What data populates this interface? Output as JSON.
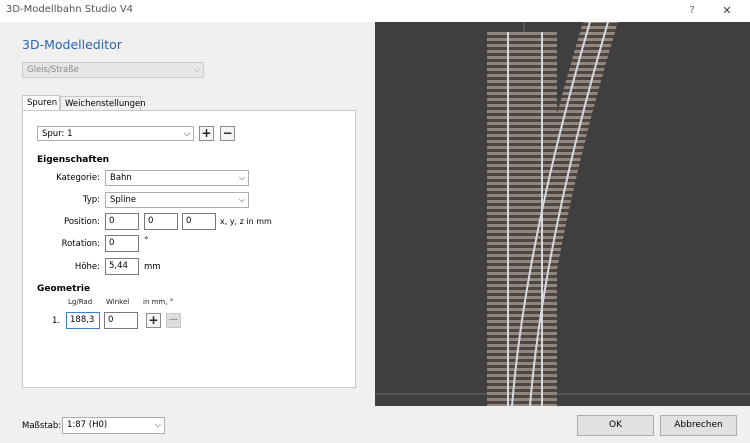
{
  "window": {
    "title": "3D-Modellbahn Studio V4",
    "help": "?",
    "close": "✕"
  },
  "editor": {
    "title": "3D-Modelleditor",
    "type_select": {
      "value": "Gleis/Straße"
    },
    "tabs": [
      {
        "label": "Spuren"
      },
      {
        "label": "Weichenstellungen"
      }
    ],
    "track_select": {
      "value": "Spur: 1"
    },
    "add": "+",
    "remove": "−",
    "properties": {
      "heading": "Eigenschaften",
      "category_label": "Kategorie:",
      "category_value": "Bahn",
      "type_label": "Typ:",
      "type_value": "Spline",
      "position_label": "Position:",
      "position_x": "0",
      "position_y": "0",
      "position_z": "0",
      "position_unit": "x, y, z in mm",
      "rotation_label": "Rotation:",
      "rotation_value": "0",
      "rotation_unit": "°",
      "height_label": "Höhe:",
      "height_value": "5,44",
      "height_unit": "mm"
    },
    "geometry": {
      "heading": "Geometrie",
      "col_length": "Lg/Rad",
      "col_angle": "Winkel",
      "col_unit": "in mm, °",
      "rows": [
        {
          "index": "1.",
          "length": "188,3",
          "angle": "0"
        }
      ],
      "add": "+",
      "remove": "—"
    }
  },
  "footer": {
    "scale_label": "Maßstab:",
    "scale_value": "1:87 (H0)",
    "ok": "OK",
    "cancel": "Abbrechen"
  },
  "colors": {
    "viewport_bg": "#3f3f3f",
    "ballast": "#8f8680",
    "rail": "#d6d9dd",
    "sleeper": "#4f4440",
    "accent": "#2a65b2"
  }
}
